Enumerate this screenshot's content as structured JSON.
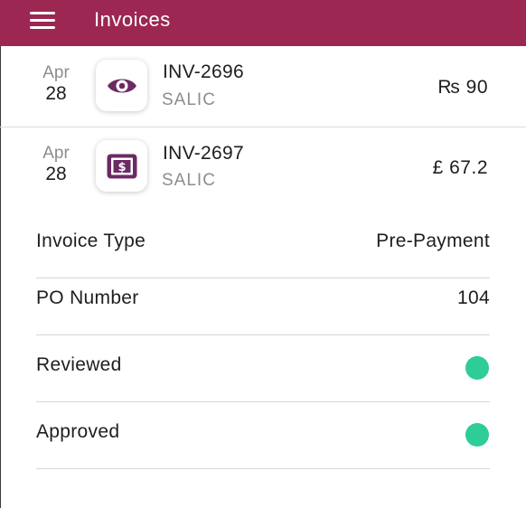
{
  "header": {
    "title": "Invoices",
    "menu_icon": "hamburger-menu-icon"
  },
  "invoices": [
    {
      "month": "Apr",
      "day": "28",
      "number": "INV-2696",
      "vendor": "SALIC",
      "amount": "₨ 90",
      "icon": "eye-icon",
      "icon_color": "#6b2a63"
    },
    {
      "month": "Apr",
      "day": "28",
      "number": "INV-2697",
      "vendor": "SALIC",
      "amount": "£ 67.2",
      "icon": "dollar-bill-icon",
      "icon_color": "#6b2a63"
    }
  ],
  "details": {
    "invoice_type": {
      "label": "Invoice Type",
      "value": "Pre-Payment"
    },
    "po_number": {
      "label": "PO Number",
      "value": "104"
    },
    "reviewed": {
      "label": "Reviewed",
      "status_color": "#2ecc96"
    },
    "approved": {
      "label": "Approved",
      "status_color": "#2ecc96"
    }
  },
  "colors": {
    "appbar": "#9c2753",
    "accent_icon": "#6b2a63",
    "status_on": "#2ecc96"
  }
}
